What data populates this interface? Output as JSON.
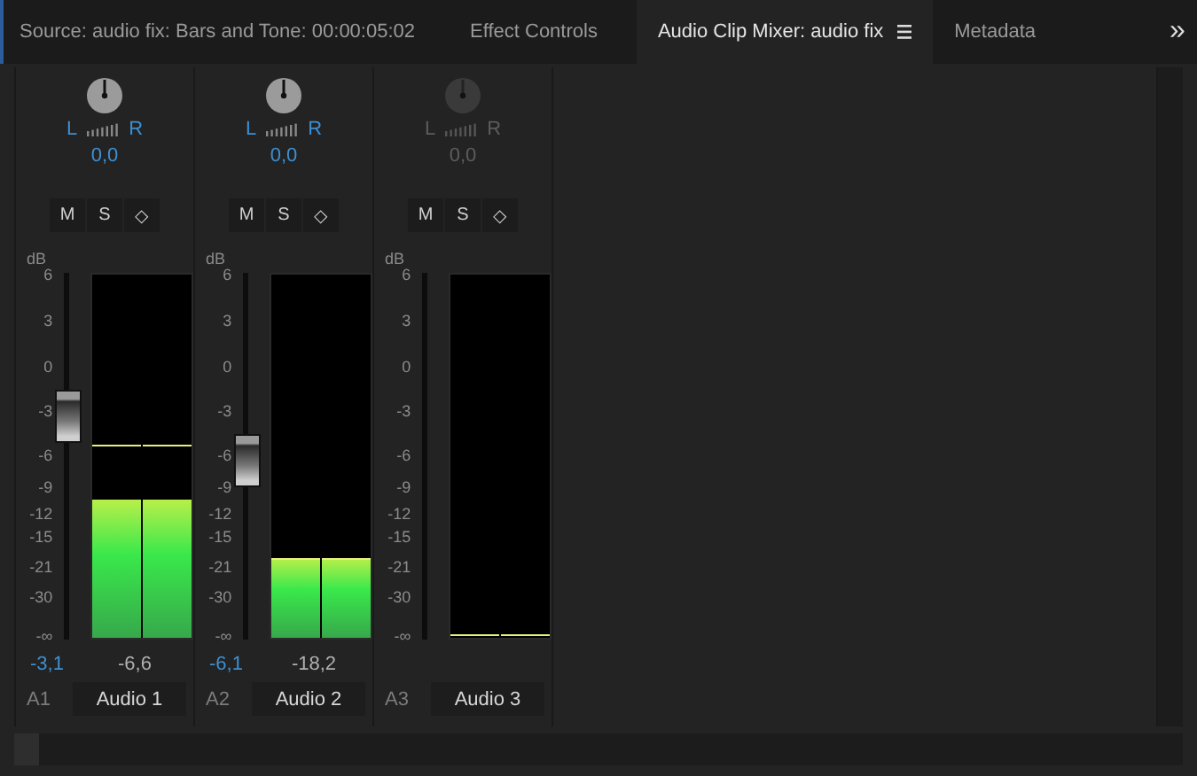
{
  "tabs": [
    {
      "label": "Source: audio fix: Bars and Tone: 00:00:05:02",
      "selected": false,
      "menu": false
    },
    {
      "label": "Effect Controls",
      "selected": false,
      "menu": false
    },
    {
      "label": "Audio Clip Mixer: audio fix",
      "selected": true,
      "menu": true
    },
    {
      "label": "Metadata",
      "selected": false,
      "menu": false
    }
  ],
  "overflow": "»",
  "channels": [
    {
      "disabled": false,
      "pan": {
        "left": "L",
        "right": "R",
        "value": "0,0"
      },
      "buttons": [
        "M",
        "S",
        "◇"
      ],
      "unit": "dB",
      "scale": [
        "6",
        "3",
        "0",
        "-3",
        "-6",
        "-9",
        "-12",
        "-15",
        "-21",
        "-30",
        "-∞"
      ],
      "fader": {
        "level": 0.61
      },
      "meter": {
        "level": 0.38
      },
      "peak": {
        "level": 0.53
      },
      "volume": "-3,1",
      "peak_reading": "-6,6",
      "track": "A1",
      "name": "Audio 1"
    },
    {
      "disabled": false,
      "pan": {
        "left": "L",
        "right": "R",
        "value": "0,0"
      },
      "buttons": [
        "M",
        "S",
        "◇"
      ],
      "unit": "dB",
      "scale": [
        "6",
        "3",
        "0",
        "-3",
        "-6",
        "-9",
        "-12",
        "-15",
        "-21",
        "-30",
        "-∞"
      ],
      "fader": {
        "level": 0.49
      },
      "meter": {
        "level": 0.22
      },
      "peak": {
        "level": 0.22
      },
      "volume": "-6,1",
      "peak_reading": "-18,2",
      "track": "A2",
      "name": "Audio 2"
    },
    {
      "disabled": true,
      "pan": {
        "left": "L",
        "right": "R",
        "value": "0,0"
      },
      "buttons": [
        "M",
        "S",
        "◇"
      ],
      "unit": "dB",
      "scale": [
        "6",
        "3",
        "0",
        "-3",
        "-6",
        "-9",
        "-12",
        "-15",
        "-21",
        "-30",
        "-∞"
      ],
      "meter": {
        "level": 0
      },
      "peak": {
        "level": 0.01
      },
      "track": "A3",
      "name": "Audio 3"
    }
  ]
}
